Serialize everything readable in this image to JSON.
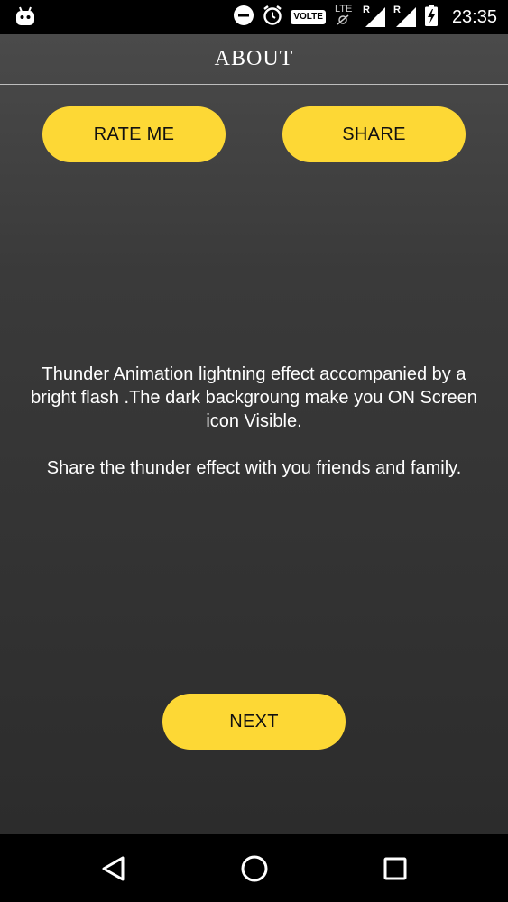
{
  "status_bar": {
    "time": "23:35",
    "volte_label": "VOLTE",
    "lte_label": "LTE",
    "roaming_label_1": "R",
    "roaming_label_2": "R",
    "icons": [
      "android-notification-icon",
      "do-not-disturb-icon",
      "alarm-icon",
      "lte-off-icon",
      "signal-roaming-icon",
      "signal-roaming-icon",
      "battery-charging-icon"
    ]
  },
  "toolbar": {
    "title": "ABOUT"
  },
  "buttons": {
    "rate_label": "RATE ME",
    "share_label": "SHARE",
    "next_label": "NEXT"
  },
  "description": {
    "paragraph_1": "Thunder Animation lightning effect accompanied by a bright flash .The dark backgroung make you ON Screen icon Visible.",
    "paragraph_2": "Share the thunder effect with you friends and family."
  },
  "nav_bar": {
    "icons": [
      "back-icon",
      "home-icon",
      "recents-icon"
    ]
  },
  "colors": {
    "accent_yellow": "#fdd835",
    "background_top": "#4a4a4a",
    "background_bottom": "#2c2c2c",
    "text": "#ffffff"
  }
}
